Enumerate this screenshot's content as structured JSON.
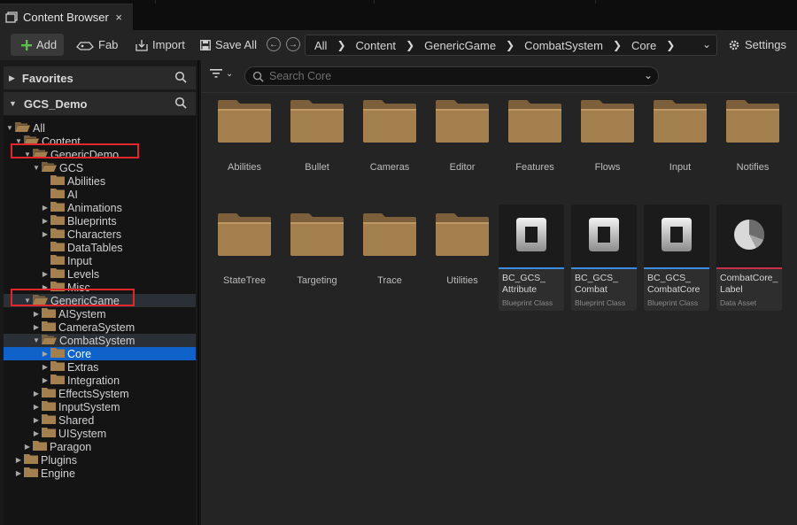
{
  "tab": {
    "title": "Content Browser",
    "close": "×"
  },
  "toolbar": {
    "add": "Add",
    "fab": "Fab",
    "import": "Import",
    "save_all": "Save All",
    "settings": "Settings"
  },
  "breadcrumb": [
    "All",
    "Content",
    "GenericGame",
    "CombatSystem",
    "Core"
  ],
  "sidebar": {
    "favorites": "Favorites",
    "project": "GCS_Demo"
  },
  "tree": [
    {
      "label": "All",
      "depth": 0,
      "arrow": "down",
      "open": true
    },
    {
      "label": "Content",
      "depth": 1,
      "arrow": "down",
      "open": true
    },
    {
      "label": "GenericDemo",
      "depth": 2,
      "arrow": "down",
      "open": true
    },
    {
      "label": "GCS",
      "depth": 3,
      "arrow": "down",
      "open": true
    },
    {
      "label": "Abilities",
      "depth": 4,
      "arrow": "none"
    },
    {
      "label": "AI",
      "depth": 4,
      "arrow": "none"
    },
    {
      "label": "Animations",
      "depth": 4,
      "arrow": "right"
    },
    {
      "label": "Blueprints",
      "depth": 4,
      "arrow": "right"
    },
    {
      "label": "Characters",
      "depth": 4,
      "arrow": "right"
    },
    {
      "label": "DataTables",
      "depth": 4,
      "arrow": "none"
    },
    {
      "label": "Input",
      "depth": 4,
      "arrow": "none"
    },
    {
      "label": "Levels",
      "depth": 4,
      "arrow": "right"
    },
    {
      "label": "Misc",
      "depth": 4,
      "arrow": "right"
    },
    {
      "label": "GenericGame",
      "depth": 2,
      "arrow": "down",
      "open": true,
      "state": "hl"
    },
    {
      "label": "AISystem",
      "depth": 3,
      "arrow": "right"
    },
    {
      "label": "CameraSystem",
      "depth": 3,
      "arrow": "right"
    },
    {
      "label": "CombatSystem",
      "depth": 3,
      "arrow": "down",
      "open": true,
      "state": "hl"
    },
    {
      "label": "Core",
      "depth": 4,
      "arrow": "right",
      "state": "sel"
    },
    {
      "label": "Extras",
      "depth": 4,
      "arrow": "right"
    },
    {
      "label": "Integration",
      "depth": 4,
      "arrow": "right"
    },
    {
      "label": "EffectsSystem",
      "depth": 3,
      "arrow": "right"
    },
    {
      "label": "InputSystem",
      "depth": 3,
      "arrow": "right"
    },
    {
      "label": "Shared",
      "depth": 3,
      "arrow": "right"
    },
    {
      "label": "UISystem",
      "depth": 3,
      "arrow": "right"
    },
    {
      "label": "Paragon",
      "depth": 2,
      "arrow": "right"
    },
    {
      "label": "Plugins",
      "depth": 1,
      "arrow": "right"
    },
    {
      "label": "Engine",
      "depth": 1,
      "arrow": "right"
    }
  ],
  "search": {
    "placeholder": "Search Core"
  },
  "folders": [
    "Abilities",
    "Bullet",
    "Cameras",
    "Editor",
    "Features",
    "Flows",
    "Input",
    "Notifies",
    "StateTree",
    "Targeting",
    "Trace",
    "Utilities"
  ],
  "assets": [
    {
      "name": "BC_GCS_ Attribute",
      "type": "Blueprint Class",
      "icon": "blueprint-class-icon",
      "color": "#3a8be0"
    },
    {
      "name": "BC_GCS_ Combat",
      "type": "Blueprint Class",
      "icon": "blueprint-class-icon",
      "color": "#3a8be0"
    },
    {
      "name": "BC_GCS_ CombatCore",
      "type": "Blueprint Class",
      "icon": "blueprint-class-icon",
      "color": "#3a8be0"
    },
    {
      "name": "CombatCore_ Label",
      "type": "Data Asset",
      "icon": "data-asset-icon",
      "color": "#c8304a"
    }
  ],
  "colors": {
    "folder": "#a5804f",
    "selection": "#0e62c9",
    "highlight_box": "#e3262b",
    "add_plus": "#5bbf4a"
  }
}
